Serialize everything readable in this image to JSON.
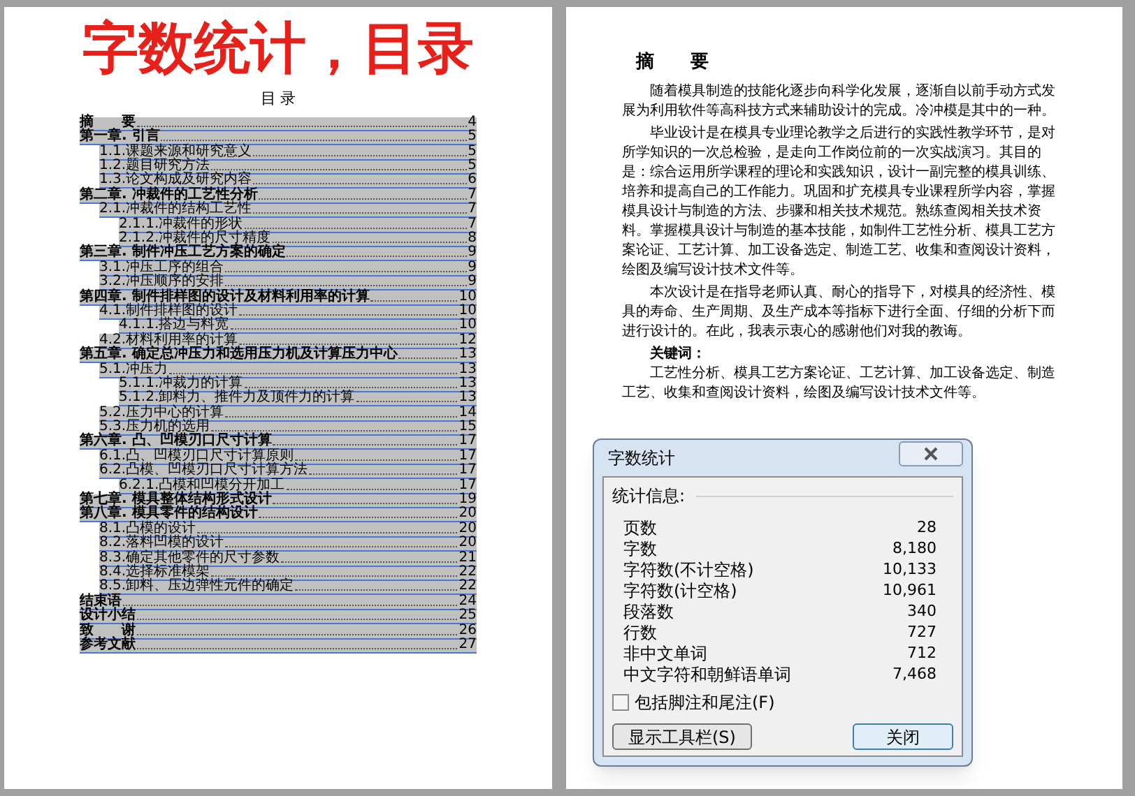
{
  "title_overlay": "字数统计，目录",
  "left_page": {
    "heading": "目 录",
    "toc": [
      {
        "title": "摘　　要",
        "page": "4"
      },
      {
        "title": "第一章. 引言",
        "page": "5",
        "children": [
          {
            "title": "1.1.课题来源和研究意义",
            "page": "5"
          },
          {
            "title": "1.2.题目研究方法",
            "page": "5"
          },
          {
            "title": "1.3.论文构成及研究内容",
            "page": "6"
          }
        ]
      },
      {
        "title": "第二章. 冲裁件的工艺性分析",
        "page": "7",
        "children": [
          {
            "title": "2.1.冲裁件的结构工艺性",
            "page": "7",
            "children": [
              {
                "title": "2.1.1.冲裁件的形状",
                "page": "7"
              },
              {
                "title": "2.1.2.冲裁件的尺寸精度",
                "page": "8"
              }
            ]
          }
        ]
      },
      {
        "title": "第三章. 制件冲压工艺方案的确定",
        "page": "9",
        "children": [
          {
            "title": "3.1.冲压工序的组合",
            "page": "9"
          },
          {
            "title": "3.2.冲压顺序的安排",
            "page": "9"
          }
        ]
      },
      {
        "title": "第四章. 制件排样图的设计及材料利用率的计算",
        "page": "10",
        "children": [
          {
            "title": "4.1.制件排样图的设计",
            "page": "10",
            "children": [
              {
                "title": "4.1.1.搭边与料宽",
                "page": "10"
              }
            ]
          },
          {
            "title": "4.2.材料利用率的计算",
            "page": "12"
          }
        ]
      },
      {
        "title": "第五章. 确定总冲压力和选用压力机及计算压力中心",
        "page": "13",
        "children": [
          {
            "title": "5.1.冲压力",
            "page": "13",
            "children": [
              {
                "title": "5.1.1.冲裁力的计算",
                "page": "13"
              },
              {
                "title": "5.1.2.卸料力、推件力及顶件力的计算",
                "page": "13"
              }
            ]
          },
          {
            "title": "5.2.压力中心的计算",
            "page": "14"
          },
          {
            "title": "5.3.压力机的选用",
            "page": "15"
          }
        ]
      },
      {
        "title": "第六章. 凸、凹模刃口尺寸计算",
        "page": "17",
        "children": [
          {
            "title": "6.1.凸、凹模刃口尺寸计算原则",
            "page": "17"
          },
          {
            "title": "6.2.凸模、凹模刃口尺寸计算方法",
            "page": "17",
            "children": [
              {
                "title": "6.2.1.凸模和凹模分开加工",
                "page": "17"
              }
            ]
          }
        ]
      },
      {
        "title": "第七章. 模具整体结构形式设计",
        "page": "19"
      },
      {
        "title": "第八章. 模具零件的结构设计",
        "page": "20",
        "children": [
          {
            "title": "8.1.凸模的设计",
            "page": "20"
          },
          {
            "title": "8.2.落料凹模的设计",
            "page": "20"
          },
          {
            "title": "8.3.确定其他零件的尺寸参数",
            "page": "21"
          },
          {
            "title": "8.4.选择标准模架",
            "page": "22"
          },
          {
            "title": "8.5.卸料、压边弹性元件的确定",
            "page": "22"
          }
        ]
      },
      {
        "title": "结束语",
        "page": "24"
      },
      {
        "title": "设计小结",
        "page": "25"
      },
      {
        "title": "致　　谢",
        "page": "26"
      },
      {
        "title": "参考文献",
        "page": "27"
      }
    ]
  },
  "right_page": {
    "heading": "摘　　要",
    "paragraphs": [
      "随着模具制造的技能化逐步向科学化发展，逐渐自以前手动方式发展为利用软件等高科技方式来辅助设计的完成。冷冲模是其中的一种。",
      "毕业设计是在模具专业理论教学之后进行的实践性教学环节，是对所学知识的一次总检验，是走向工作岗位前的一次实战演习。其目的是：综合运用所学课程的理论和实践知识，设计一副完整的模具训练、培养和提高自己的工作能力。巩固和扩充模具专业课程所学内容，掌握模具设计与制造的方法、步骤和相关技术规范。熟练查阅相关技术资料。掌握模具设计与制造的基本技能，如制件工艺性分析、模具工艺方案论证、工艺计算、加工设备选定、制造工艺、收集和查阅设计资料，绘图及编写设计技术文件等。",
      "本次设计是在指导老师认真、耐心的指导下，对模具的经济性、模具的寿命、生产周期、及生产成本等指标下进行全面、仔细的分析下而进行设计的。在此，我表示衷心的感谢他们对我的教诲。"
    ],
    "keywords_label": "关键词：",
    "keywords": "工艺性分析、模具工艺方案论证、工艺计算、加工设备选定、制造工艺、收集和查阅设计资料，绘图及编写设计技术文件等。"
  },
  "dialog": {
    "title": "字数统计",
    "section_label": "统计信息:",
    "stats": [
      {
        "label": "页数",
        "value": "28"
      },
      {
        "label": "字数",
        "value": "8,180"
      },
      {
        "label": "字符数(不计空格)",
        "value": "10,133"
      },
      {
        "label": "字符数(计空格)",
        "value": "10,961"
      },
      {
        "label": "段落数",
        "value": "340"
      },
      {
        "label": "行数",
        "value": "727"
      },
      {
        "label": "非中文单词",
        "value": "712"
      },
      {
        "label": "中文字符和朝鲜语单词",
        "value": "7,468"
      }
    ],
    "checkbox": {
      "label": "包括脚注和尾注(F)",
      "checked": false
    },
    "buttons": [
      {
        "label": "显示工具栏(S)",
        "kind": "secondary"
      },
      {
        "label": "关闭",
        "kind": "default"
      }
    ]
  }
}
